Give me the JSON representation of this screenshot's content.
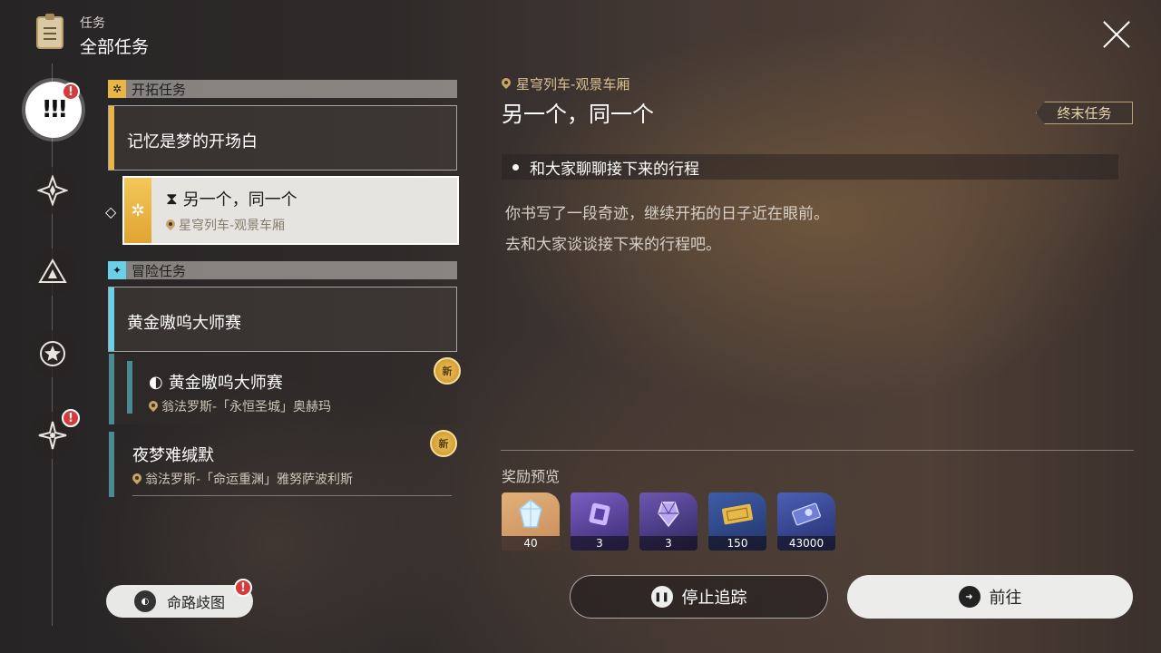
{
  "header": {
    "category": "任务",
    "title": "全部任务"
  },
  "rail": {
    "alert_mark": "!"
  },
  "sections": {
    "trailblaze": {
      "label": "开拓任务"
    },
    "adventure": {
      "label": "冒险任务"
    }
  },
  "quests": {
    "q1": {
      "title": "记忆是梦的开场白"
    },
    "q2": {
      "title": "另一个，同一个",
      "location": "星穹列车-观景车厢"
    },
    "q3": {
      "title": "黄金嗷呜大师赛"
    },
    "q4": {
      "title": "黄金嗷呜大师赛",
      "location": "翁法罗斯-「永恒圣城」奥赫玛",
      "badge": "新"
    },
    "q5": {
      "title": "夜梦难缄默",
      "location": "翁法罗斯-「命运重渊」雅努萨波利斯",
      "badge": "新"
    }
  },
  "detail": {
    "location": "星穹列车-观景车厢",
    "title": "另一个，同一个",
    "tag": "终末任务",
    "objective": "和大家聊聊接下来的行程",
    "description": [
      "你书写了一段奇迹，继续开拓的日子近在眼前。",
      "去和大家谈谈接下来的行程吧。"
    ]
  },
  "rewards": {
    "label": "奖励预览",
    "items": [
      {
        "icon": "crystal-icon",
        "qty": "40"
      },
      {
        "icon": "purple-chip-icon",
        "qty": "3"
      },
      {
        "icon": "purple-material-icon",
        "qty": "3"
      },
      {
        "icon": "gold-ticket-icon",
        "qty": "150"
      },
      {
        "icon": "credit-card-icon",
        "qty": "43000"
      }
    ]
  },
  "buttons": {
    "stop": "停止追踪",
    "go": "前往",
    "path": "命路歧图"
  },
  "colors": {
    "trailblaze_accent": "#e9b547",
    "adventure_accent": "#6ad0e8"
  }
}
